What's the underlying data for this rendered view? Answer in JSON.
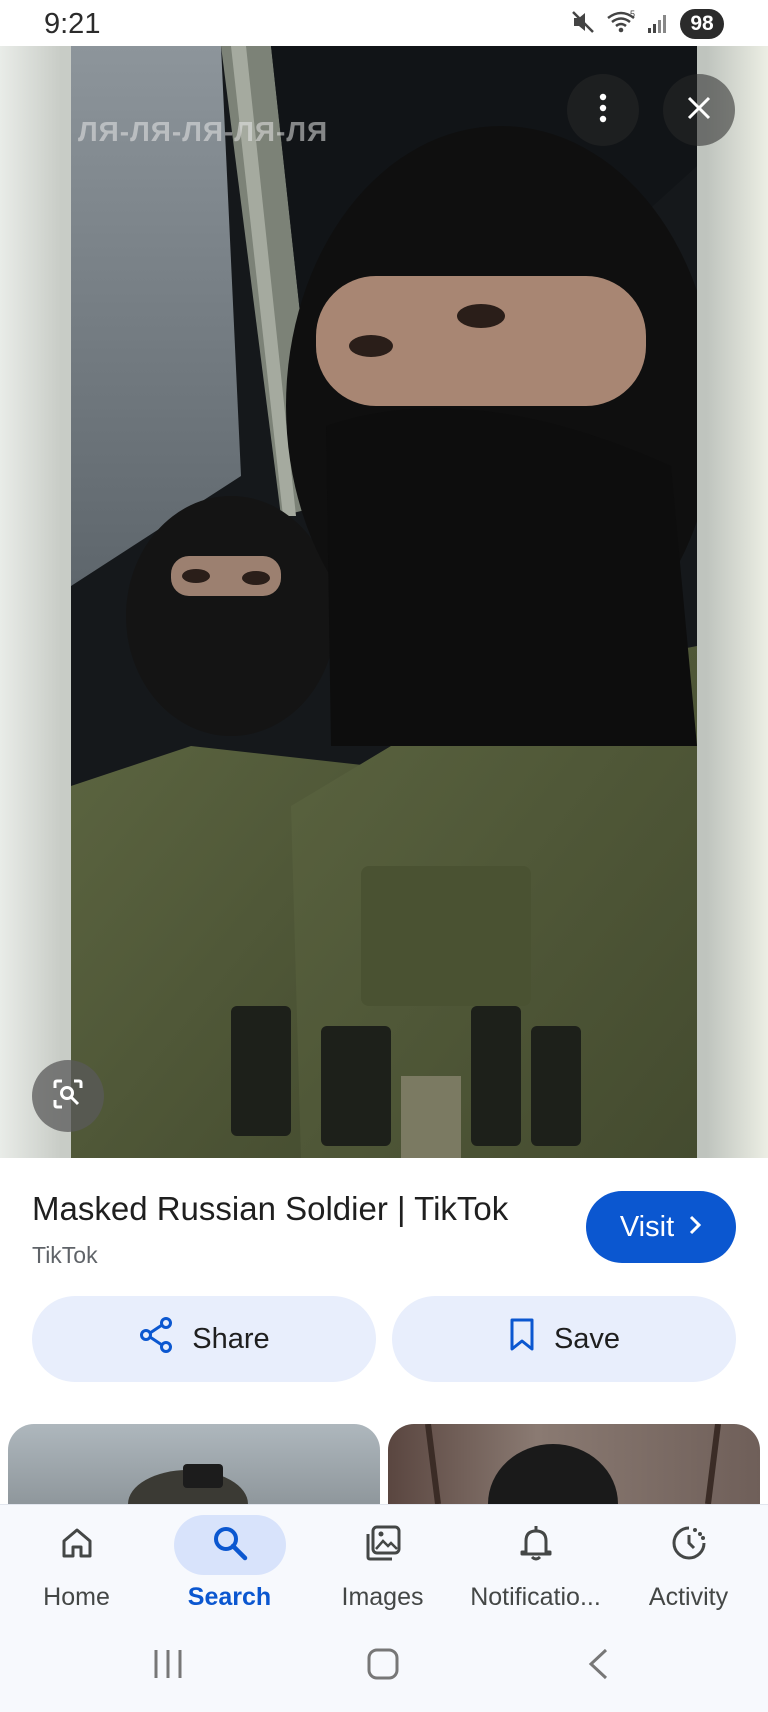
{
  "status_bar": {
    "time": "9:21",
    "battery": "98",
    "icons": [
      "mute-icon",
      "wifi-icon",
      "signal-icon"
    ]
  },
  "viewer": {
    "overlay_text": "ЛЯ-ЛЯ-ЛЯ-ЛЯ-ЛЯ",
    "icons": [
      "more-vert-icon",
      "close-icon",
      "lens-icon"
    ]
  },
  "result": {
    "title": "Masked Russian Soldier | TikTok",
    "source": "TikTok",
    "visit_label": "Visit"
  },
  "actions": {
    "share_label": "Share",
    "save_label": "Save"
  },
  "bottom_nav": {
    "items": [
      {
        "label": "Home",
        "icon": "home-icon",
        "active": false
      },
      {
        "label": "Search",
        "icon": "search-icon",
        "active": true
      },
      {
        "label": "Images",
        "icon": "images-icon",
        "active": false
      },
      {
        "label": "Notificatio...",
        "icon": "bell-icon",
        "active": false
      },
      {
        "label": "Activity",
        "icon": "activity-icon",
        "active": false
      }
    ]
  },
  "colors": {
    "accent": "#0b57d0",
    "tonal_button": "#e8eefc",
    "active_nav_pill": "#d8e3fb"
  }
}
